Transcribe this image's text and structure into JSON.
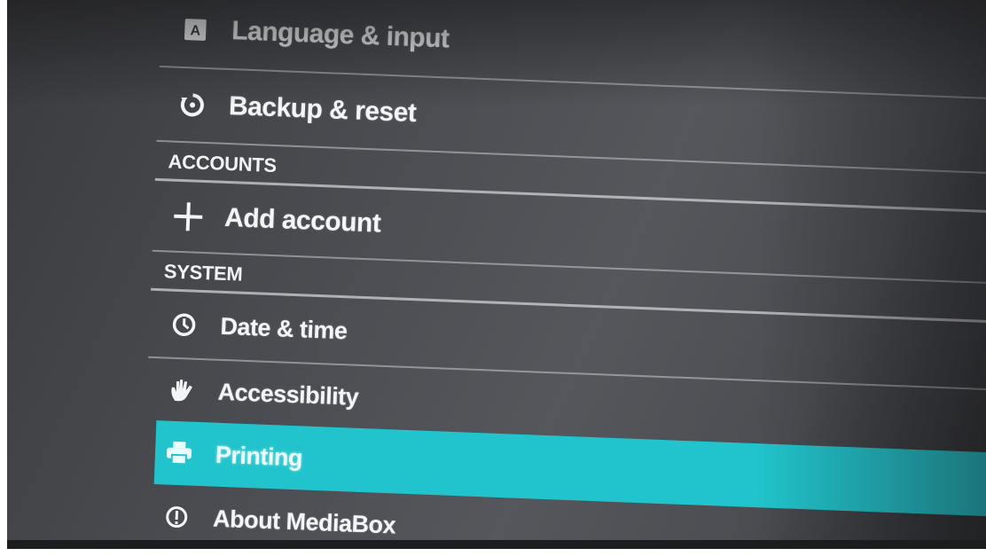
{
  "settings": {
    "items": [
      {
        "id": "language",
        "label": "Language & input",
        "icon": "language-icon"
      },
      {
        "id": "backup",
        "label": "Backup & reset",
        "icon": "backup-icon"
      }
    ],
    "accounts": {
      "header": "ACCOUNTS",
      "items": [
        {
          "id": "add-account",
          "label": "Add account",
          "icon": "plus-icon"
        }
      ]
    },
    "system": {
      "header": "SYSTEM",
      "items": [
        {
          "id": "date-time",
          "label": "Date & time",
          "icon": "clock-icon"
        },
        {
          "id": "accessibility",
          "label": "Accessibility",
          "icon": "hand-icon"
        },
        {
          "id": "printing",
          "label": "Printing",
          "icon": "printer-icon",
          "selected": true
        },
        {
          "id": "about",
          "label": "About MediaBox",
          "icon": "info-icon"
        }
      ]
    },
    "colors": {
      "highlight": "#21c4cc",
      "background": "#4a4c51",
      "divider": "#c8cdd2"
    }
  }
}
